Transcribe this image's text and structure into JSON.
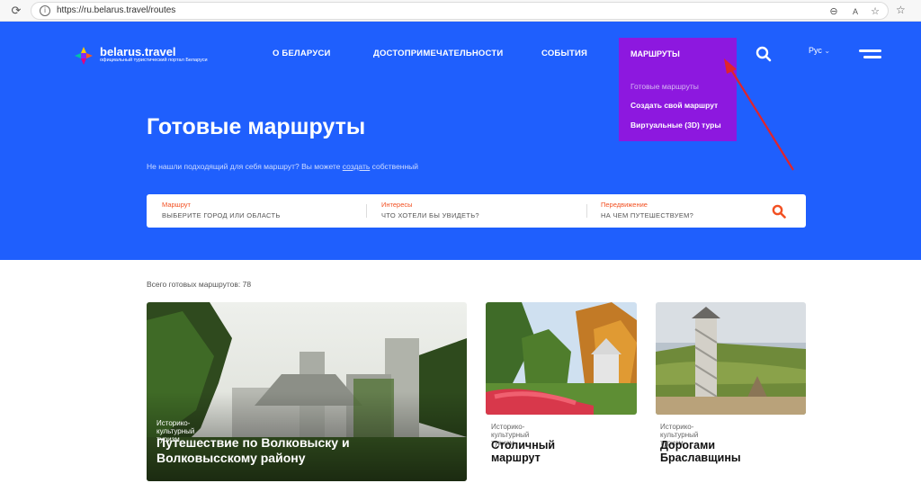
{
  "browser": {
    "url": "https://ru.belarus.travel/routes",
    "icons": [
      "reload-icon",
      "lock-icon",
      "zoom-icon",
      "read-aloud-icon",
      "favorite-star-icon",
      "favorites-icon"
    ]
  },
  "header": {
    "brand": "belarus.travel",
    "brand_sub": "официальный туристический портал Беларуси",
    "nav": [
      "О БЕЛАРУСИ",
      "ДОСТОПРИМЕЧАТЕЛЬНОСТИ",
      "СОБЫТИЯ"
    ],
    "lang": "Рус",
    "lang_arrow": "⌄"
  },
  "dropdown": {
    "title": "МАРШРУТЫ",
    "items": [
      "Готовые маршруты",
      "Создать свой маршрут",
      "Виртуальные (3D) туры"
    ]
  },
  "hero": {
    "title": "Готовые маршруты",
    "sub_before": "Не нашли подходящий для себя маршрут? Вы можете ",
    "sub_link": "создать",
    "sub_after": " собственный"
  },
  "search": {
    "fields": [
      {
        "caption": "Маршрут",
        "value": "ВЫБЕРИТЕ ГОРОД ИЛИ ОБЛАСТЬ"
      },
      {
        "caption": "Интересы",
        "value": "ЧТО ХОТЕЛИ БЫ УВИДЕТЬ?"
      },
      {
        "caption": "Передвижение",
        "value": "НА ЧЕМ ПУТЕШЕСТВУЕМ?"
      }
    ]
  },
  "content": {
    "count": "Всего готовых маршрутов: 78",
    "cards": [
      {
        "tag": "Историко-культурный туризм",
        "title": "Путешествие по Волковыску и Волковысскому району"
      },
      {
        "tag": "Историко-культурный туризм",
        "title": "Столичный маршрут"
      },
      {
        "tag": "Историко-культурный туризм",
        "title": "Дорогами Браславщины"
      }
    ]
  },
  "colors": {
    "hero_bg": "#1f5ffd",
    "dropdown_bg": "#8d18df",
    "accent": "#f25022",
    "annotation_arrow": "#e0242c"
  }
}
